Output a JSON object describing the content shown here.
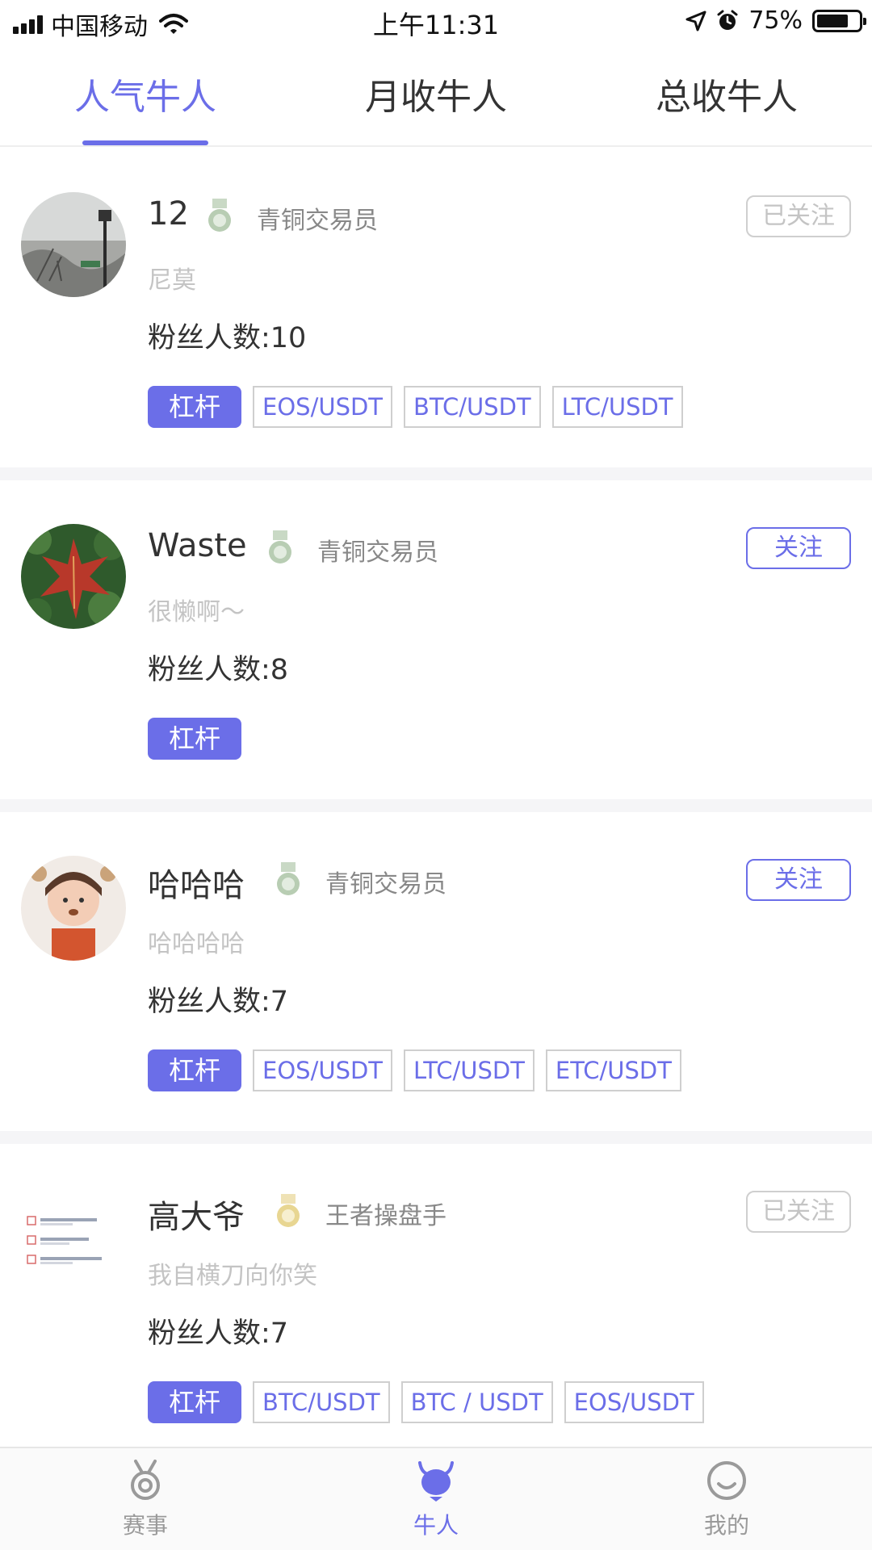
{
  "status_bar": {
    "carrier": "中国移动",
    "time": "上午11:31",
    "battery": "75%",
    "battery_level": 0.75,
    "icons": [
      "signal-icon",
      "wifi-icon",
      "location-icon",
      "alarm-icon",
      "battery-icon"
    ]
  },
  "tabs": [
    {
      "label": "人气牛人",
      "active": true
    },
    {
      "label": "月收牛人",
      "active": false
    },
    {
      "label": "总收牛人",
      "active": false
    }
  ],
  "traders": [
    {
      "name": "12",
      "level": "青铜交易员",
      "bio": "尼莫",
      "fans": "粉丝人数:10",
      "follow_label": "已关注",
      "followed": true,
      "tags": [
        "杠杆",
        "EOS/USDT",
        "BTC/USDT",
        "LTC/USDT"
      ]
    },
    {
      "name": "Waste",
      "level": "青铜交易员",
      "bio": "很懒啊～",
      "fans": "粉丝人数:8",
      "follow_label": "关注",
      "followed": false,
      "tags": [
        "杠杆"
      ]
    },
    {
      "name": "哈哈哈",
      "level": "青铜交易员",
      "bio": "哈哈哈哈",
      "fans": "粉丝人数:7",
      "follow_label": "关注",
      "followed": false,
      "tags": [
        "杠杆",
        "EOS/USDT",
        "LTC/USDT",
        "ETC/USDT"
      ]
    },
    {
      "name": "高大爷",
      "level": "王者操盘手",
      "bio": "我自横刀向你笑",
      "fans": "粉丝人数:7",
      "follow_label": "已关注",
      "followed": true,
      "tags": [
        "杠杆",
        "BTC/USDT",
        "BTC / USDT",
        "EOS/USDT"
      ]
    }
  ],
  "bottom_nav": [
    {
      "label": "赛事",
      "icon": "medal-icon",
      "active": false
    },
    {
      "label": "牛人",
      "icon": "bull-icon",
      "active": true
    },
    {
      "label": "我的",
      "icon": "profile-icon",
      "active": false
    }
  ],
  "colors": {
    "accent": "#6b6ee8",
    "muted": "#c4c4c4",
    "text": "#333333",
    "bronze_medal": "#a9c4a4",
    "gold_medal": "#e6d59a"
  }
}
